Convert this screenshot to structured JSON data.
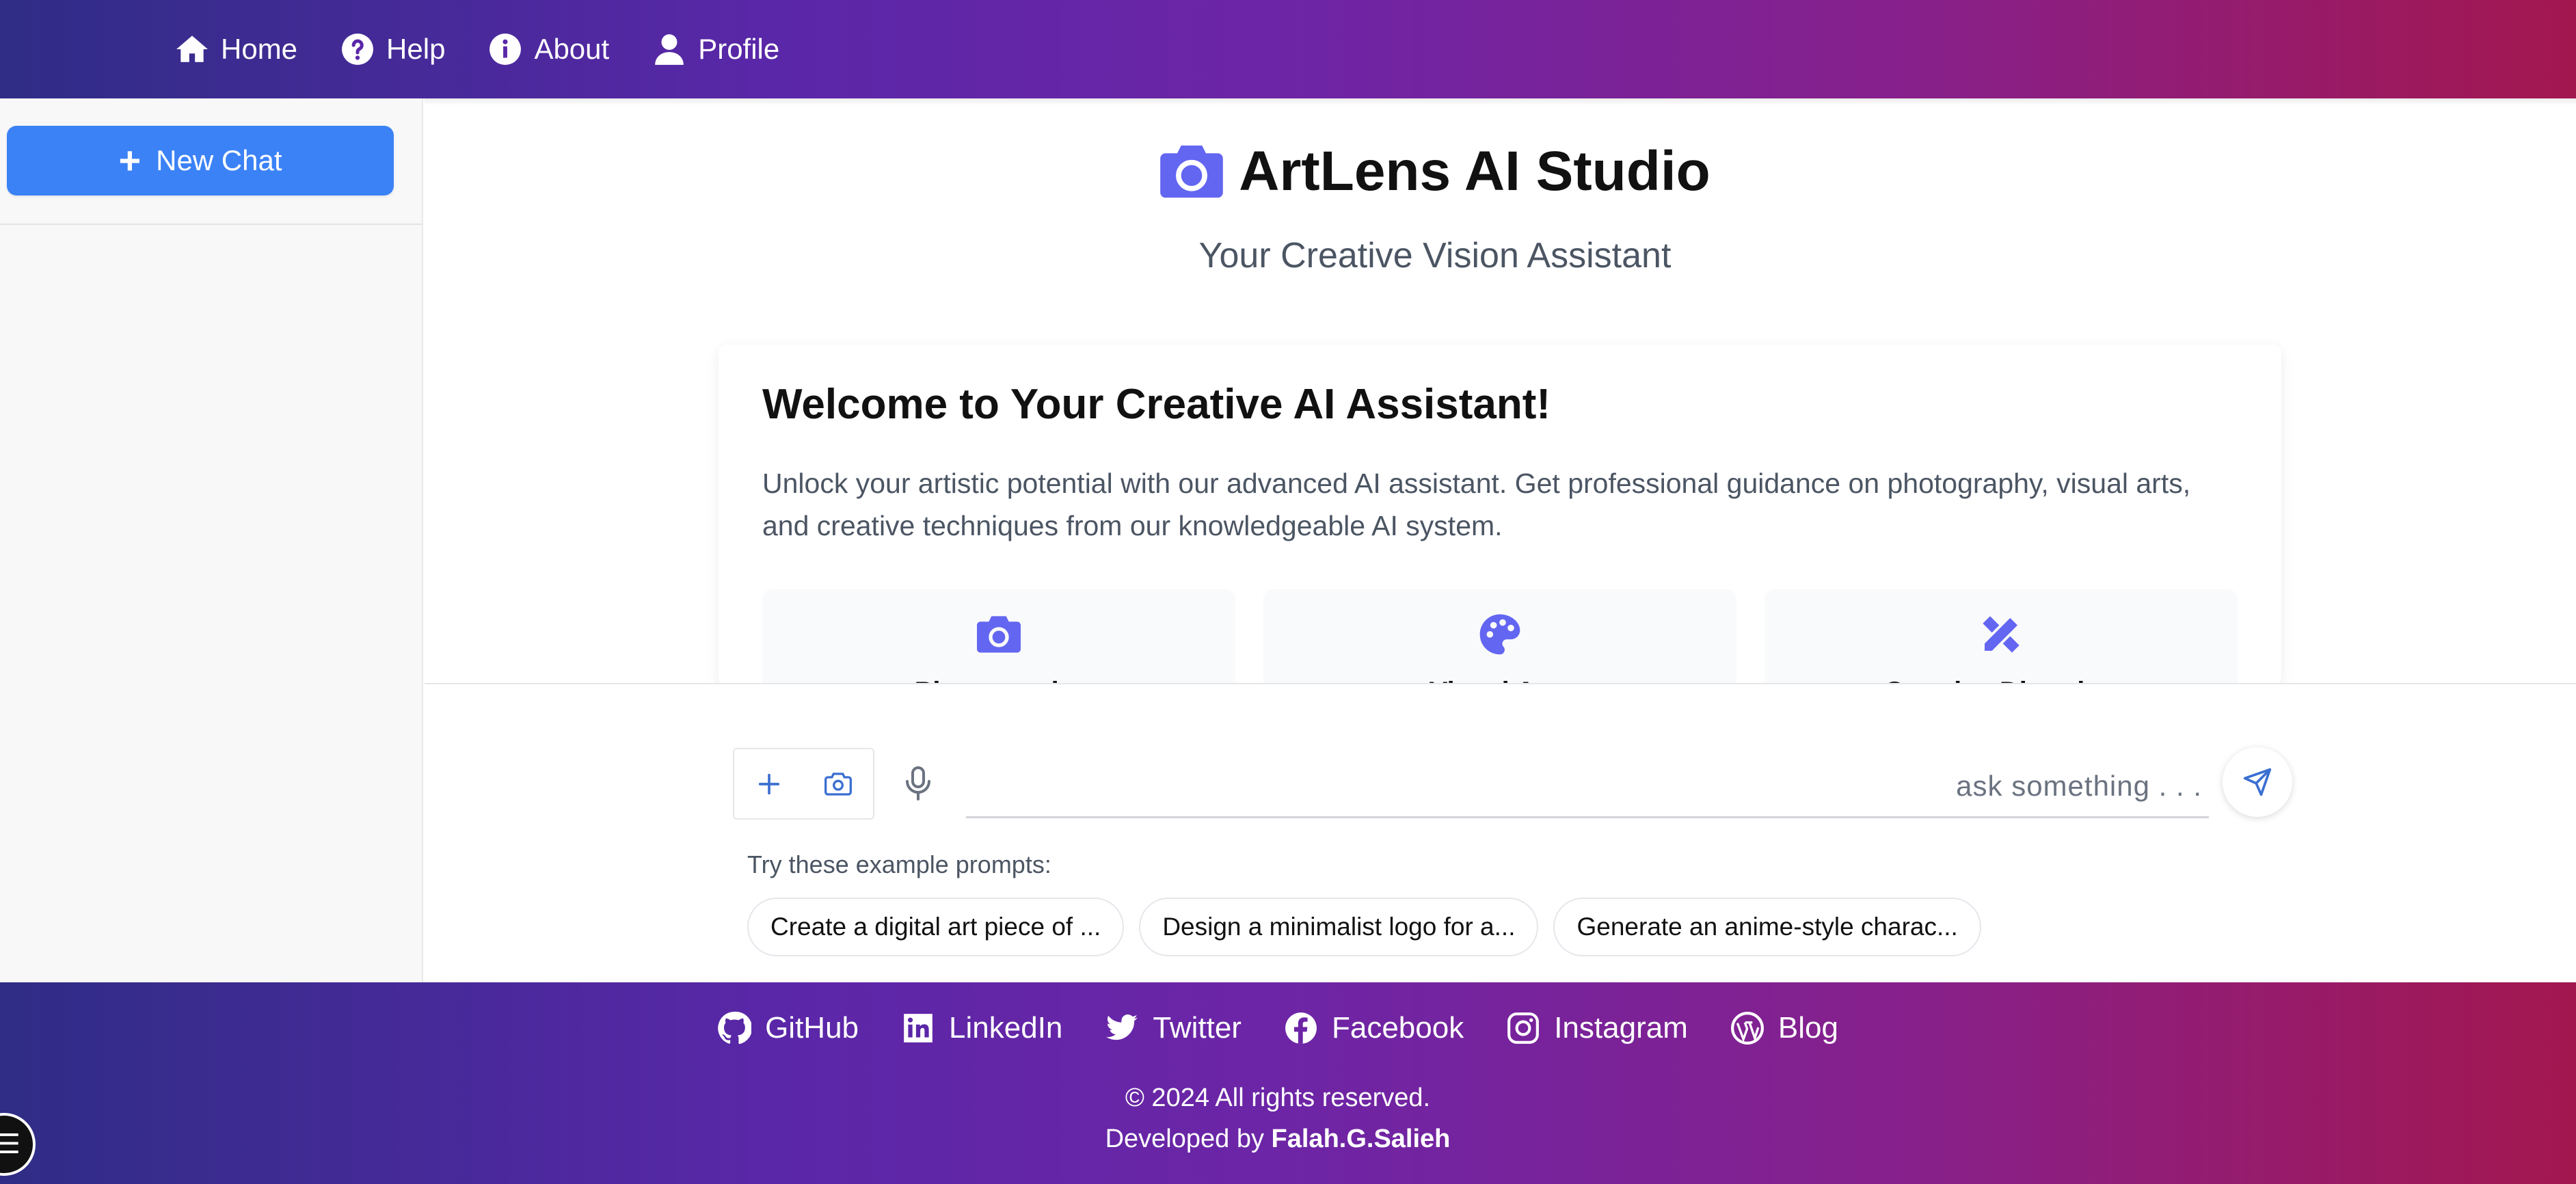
{
  "nav": {
    "items": [
      {
        "label": "Home",
        "icon": "home-icon"
      },
      {
        "label": "Help",
        "icon": "help-icon"
      },
      {
        "label": "About",
        "icon": "info-icon"
      },
      {
        "label": "Profile",
        "icon": "user-icon"
      }
    ]
  },
  "sidebar": {
    "new_chat_label": "New Chat"
  },
  "header": {
    "title": "ArtLens AI Studio",
    "subtitle": "Your Creative Vision Assistant",
    "accent_color": "#6366f1"
  },
  "welcome": {
    "title": "Welcome to Your Creative AI Assistant!",
    "text": "Unlock your artistic potential with our advanced AI assistant. Get professional guidance on photography, visual arts, and creative techniques from our knowledgeable AI system.",
    "features": [
      {
        "label": "Photography",
        "icon": "camera-icon"
      },
      {
        "label": "Visual Arts",
        "icon": "palette-icon"
      },
      {
        "label": "Creative Direction",
        "icon": "pencil-ruler-icon"
      }
    ]
  },
  "composer": {
    "placeholder": "ask something . . .",
    "examples_label": "Try these example prompts:",
    "examples": [
      "Create a digital art piece of ...",
      "Design a minimalist logo for a...",
      "Generate an anime-style charac..."
    ]
  },
  "footer": {
    "links": [
      {
        "label": "GitHub",
        "icon": "github-icon"
      },
      {
        "label": "LinkedIn",
        "icon": "linkedin-icon"
      },
      {
        "label": "Twitter",
        "icon": "twitter-icon"
      },
      {
        "label": "Facebook",
        "icon": "facebook-icon"
      },
      {
        "label": "Instagram",
        "icon": "instagram-icon"
      },
      {
        "label": "Blog",
        "icon": "wordpress-icon"
      }
    ],
    "copyright": "© 2024 All rights reserved.",
    "developed_by_prefix": "Developed by ",
    "developer_name": "Falah.G.Salieh"
  },
  "colors": {
    "primary_button": "#3b82f6",
    "gradient_start": "#2f2d86",
    "gradient_end": "#a3174f"
  }
}
